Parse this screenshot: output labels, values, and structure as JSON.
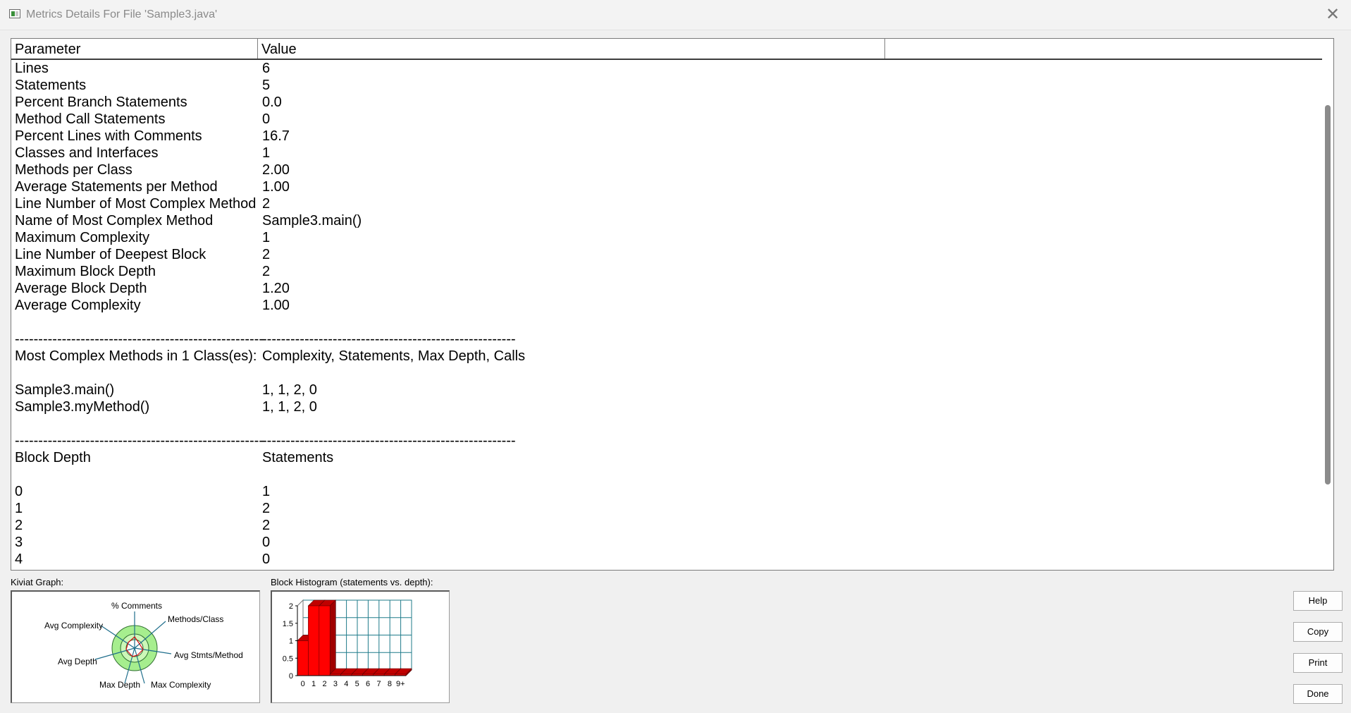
{
  "window": {
    "title": "Metrics Details For File 'Sample3.java'",
    "close_glyph": "✕"
  },
  "table": {
    "headers": [
      "Parameter",
      "Value"
    ],
    "rows": [
      [
        "Lines",
        "6"
      ],
      [
        "Statements",
        "5"
      ],
      [
        "Percent Branch Statements",
        "0.0"
      ],
      [
        "Method Call Statements",
        "0"
      ],
      [
        "Percent Lines with Comments",
        "16.7"
      ],
      [
        "Classes and Interfaces",
        "1"
      ],
      [
        "Methods per Class",
        "2.00"
      ],
      [
        "Average Statements per Method",
        "1.00"
      ],
      [
        "Line Number of Most Complex Method",
        "2"
      ],
      [
        "Name of Most Complex Method",
        "Sample3.main()"
      ],
      [
        "Maximum Complexity",
        "1"
      ],
      [
        "Line Number of Deepest Block",
        "2"
      ],
      [
        "Maximum Block Depth",
        "2"
      ],
      [
        "Average Block Depth",
        "1.20"
      ],
      [
        "Average Complexity",
        "1.00"
      ],
      [
        "",
        ""
      ],
      [
        "-----------------------------------------------------",
        "------------------------------------------------------"
      ],
      [
        "Most Complex Methods in 1 Class(es):",
        "Complexity, Statements, Max Depth, Calls"
      ],
      [
        "",
        ""
      ],
      [
        "Sample3.main()",
        "1, 1, 2, 0"
      ],
      [
        "Sample3.myMethod()",
        "1, 1, 2, 0"
      ],
      [
        "",
        ""
      ],
      [
        "-----------------------------------------------------",
        "------------------------------------------------------"
      ],
      [
        "Block Depth",
        "Statements"
      ],
      [
        "",
        ""
      ],
      [
        "0",
        "1"
      ],
      [
        "1",
        "2"
      ],
      [
        "2",
        "2"
      ],
      [
        "3",
        "0"
      ],
      [
        "4",
        "0"
      ]
    ]
  },
  "kiviat": {
    "label": "Kiviat Graph:",
    "axes": [
      "% Comments",
      "Methods/Class",
      "Avg Stmts/Method",
      "Max Complexity",
      "Max Depth",
      "Avg Depth",
      "Avg Complexity"
    ],
    "ring_color": "#a6ee8e",
    "inner_color": "#ccf7b8",
    "spoke_color": "#1f6e8c",
    "plot_color": "#d01010"
  },
  "histogram": {
    "label": "Block Histogram (statements vs. depth):",
    "bar_color": "#ff0000",
    "grid_color": "#1f7b8a"
  },
  "chart_data": {
    "type": "bar",
    "title": "Block Histogram (statements vs. depth):",
    "categories": [
      "0",
      "1",
      "2",
      "3",
      "4",
      "5",
      "6",
      "7",
      "8",
      "9+"
    ],
    "values": [
      1,
      2,
      2,
      0,
      0,
      0,
      0,
      0,
      0,
      0
    ],
    "ylim": [
      0,
      2
    ],
    "yticks": [
      "0",
      "0.5",
      "1",
      "1.5",
      "2"
    ],
    "grid": true
  },
  "buttons": {
    "help": "Help",
    "copy": "Copy",
    "print": "Print",
    "done": "Done"
  }
}
